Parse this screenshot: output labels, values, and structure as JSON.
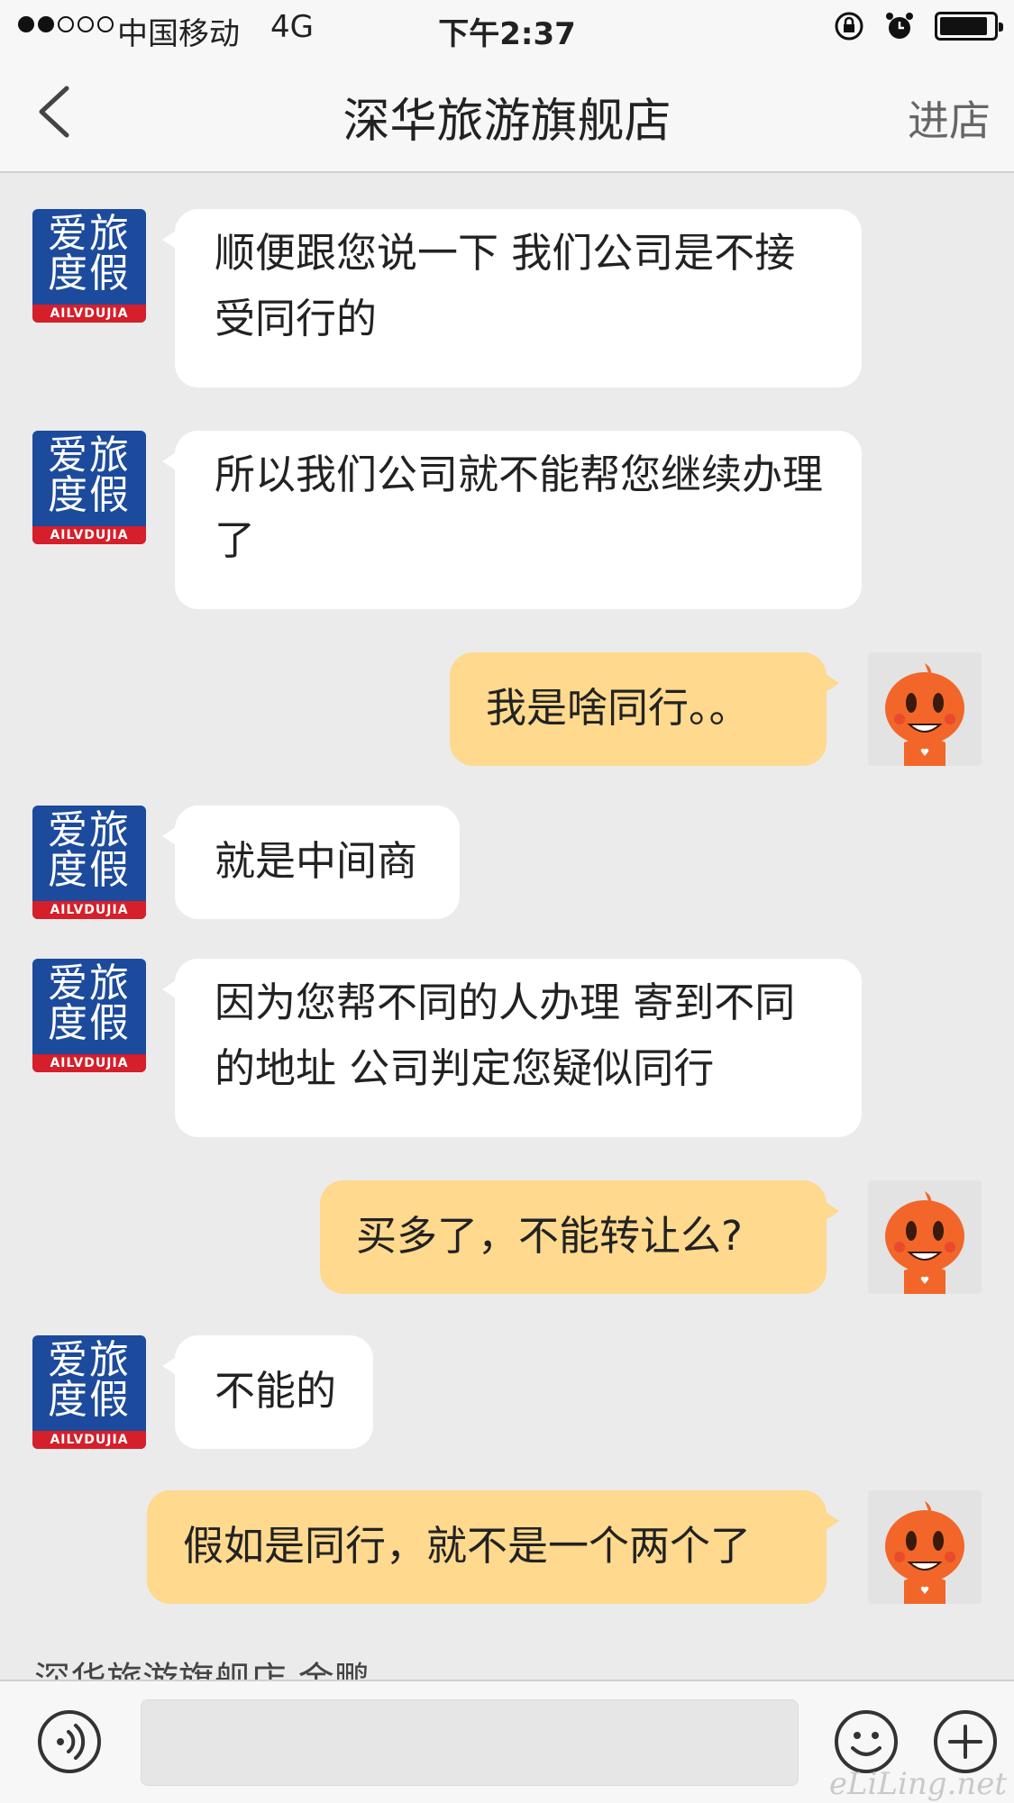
{
  "status_bar": {
    "carrier": "中国移动",
    "network": "4G",
    "time": "下午2:37"
  },
  "nav": {
    "title": "深华旅游旗舰店",
    "action": "进店"
  },
  "shop_avatar": {
    "line1": "爱旅",
    "line2": "度假",
    "banner": "AILVDUJIA"
  },
  "messages": [
    {
      "side": "left",
      "text": "顺便跟您说一下 我们公司是不接受同行的"
    },
    {
      "side": "left",
      "text": "所以我们公司就不能帮您继续办理了"
    },
    {
      "side": "right",
      "text": "我是啥同行。。"
    },
    {
      "side": "left",
      "text": "就是中间商"
    },
    {
      "side": "left",
      "text": "因为您帮不同的人办理 寄到不同的地址 公司判定您疑似同行"
    },
    {
      "side": "right",
      "text": "买多了，不能转让么?"
    },
    {
      "side": "left",
      "text": "不能的"
    },
    {
      "side": "right",
      "text": "假如是同行，就不是一个两个了"
    }
  ],
  "typing_indicator": "深华旅游旗舰店 金鹏",
  "input_bar": {
    "placeholder": "",
    "voice_icon": "voice-icon",
    "emoji_icon": "emoji-icon",
    "plus_icon": "plus-icon"
  },
  "watermark": "eLiLing.net",
  "colors": {
    "chat_bg": "#ebebeb",
    "incoming_bubble": "#ffffff",
    "outgoing_bubble": "#fed98e",
    "brand_blue": "#1c4a9c",
    "brand_red": "#d51f2a",
    "mascot_orange": "#f2662a"
  }
}
